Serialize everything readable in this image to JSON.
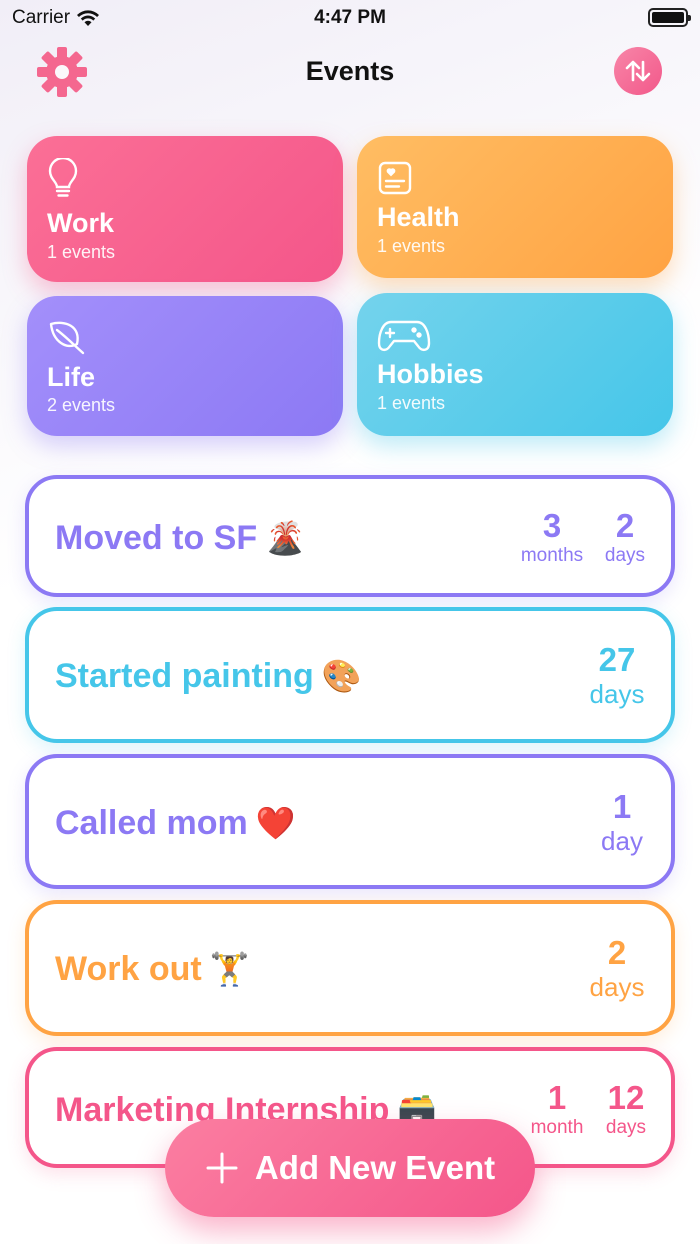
{
  "status_bar": {
    "carrier": "Carrier",
    "time": "4:47 PM"
  },
  "nav": {
    "title": "Events",
    "left_icon": "gear-icon",
    "right_icon": "sort-arrows-icon"
  },
  "categories": [
    {
      "name": "Work",
      "count": "1 events",
      "icon": "lightbulb-icon",
      "color": "#f4568a"
    },
    {
      "name": "Health",
      "count": "1 events",
      "icon": "health-card-icon",
      "color": "#ffa343"
    },
    {
      "name": "Life",
      "count": "2 events",
      "icon": "leaf-icon",
      "color": "#8c79f4"
    },
    {
      "name": "Hobbies",
      "count": "1 events",
      "icon": "gamepad-icon",
      "color": "#45c6e9"
    }
  ],
  "events": [
    {
      "title": "Moved to SF",
      "emoji": "🌋",
      "counters": [
        {
          "num": "3",
          "unit": "months"
        },
        {
          "num": "2",
          "unit": "days"
        }
      ],
      "color": "#8c79f4"
    },
    {
      "title": "Started painting",
      "emoji": "🎨",
      "counters": [
        {
          "num": "27",
          "unit": "days"
        }
      ],
      "color": "#45c6e9"
    },
    {
      "title": "Called mom",
      "emoji": "❤️",
      "counters": [
        {
          "num": "1",
          "unit": "day"
        }
      ],
      "color": "#8c79f4"
    },
    {
      "title": "Work out",
      "emoji": "🏋️",
      "counters": [
        {
          "num": "2",
          "unit": "days"
        }
      ],
      "color": "#ffa343"
    },
    {
      "title": "Marketing Internship",
      "emoji": "🗃️",
      "counters": [
        {
          "num": "1",
          "unit": "month"
        },
        {
          "num": "12",
          "unit": "days"
        }
      ],
      "color": "#f4568a"
    }
  ],
  "add_button": {
    "label": "Add New Event",
    "icon": "plus-icon"
  }
}
